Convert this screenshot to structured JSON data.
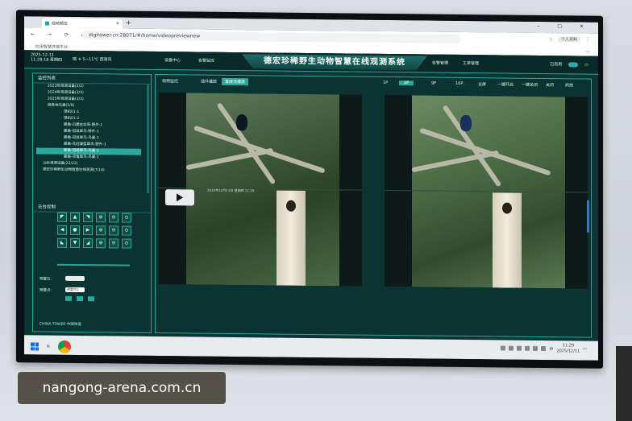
{
  "browser": {
    "tab_title": "视频预览",
    "new_tab": "+",
    "url": "digitower.cn:28071/#/home/videopreviewnew",
    "bookmark": "应用智慧终端平台",
    "profile": "个人资料",
    "window_controls": "–  □  ✕",
    "nav_icons": "←  →  ⟳  ⌂"
  },
  "app": {
    "date": "2025-12-11",
    "time_weekday": "11:29:18 星期四",
    "weather": "晴 ☀ 5~11℃ 西南风",
    "nav_left": [
      "设备中心",
      "告警监控"
    ],
    "title": "德宏珍稀野生动物智慧在线观测系统",
    "nav_right": [
      "告警管理",
      "工单管理"
    ],
    "right_status": "已启用"
  },
  "left_panel": {
    "list_title": "监控列表",
    "tree": [
      "2023年观测设备(2/2)",
      "2024年观测设备(3/3)",
      "2025年观测设备(3/3)",
      "栖息地鸟巢(5/9)",
      "球机01-1",
      "球机01-2",
      "鹿角-白腹金丝燕-野外-1",
      "鹿角-冠斑犀鸟-野外-1",
      "鹿角-冠斑犀鸟-鸟巢-1",
      "鹿角-花冠皱盔犀鸟-野外-1",
      "鹿角-冠斑犀鸟-鸟巢-1",
      "鹿角-双角犀鸟-鸟巢-1",
      "山岭观测设备(22/22)",
      "德宏珍稀野生动物智慧在线观测(7/14)"
    ],
    "selected_index": 10,
    "ptz_title": "云台控制",
    "ptz_buttons": [
      "◤",
      "▲",
      "◥",
      "⊕",
      "⊖",
      "⊙",
      "◀",
      "●",
      "▶",
      "⊕",
      "⊖",
      "⊙",
      "◣",
      "▼",
      "◢",
      "⊕",
      "⊖",
      "⊙"
    ],
    "preset_label": "预置位:",
    "speed_label": "预置点:",
    "preset_value": "预置点1",
    "logo": "CHINA TOWER 中国铁塔"
  },
  "main_panel": {
    "title": "视频监控",
    "tabs": [
      "插件播放",
      "直接流播放"
    ],
    "active_tab": 1,
    "layouts": [
      "1P",
      "4P",
      "9P",
      "16P",
      "全屏",
      "一键开启",
      "一键关闭",
      "关闭",
      "抓拍"
    ],
    "active_layout": 1,
    "video_caption": "2025年12月11日 星期四 11:29",
    "watermark_cam": "©2025"
  },
  "taskbar": {
    "time": "11:29",
    "date": "2025/12/11",
    "lang": "中"
  },
  "watermark": "nangong-arena.com.cn"
}
